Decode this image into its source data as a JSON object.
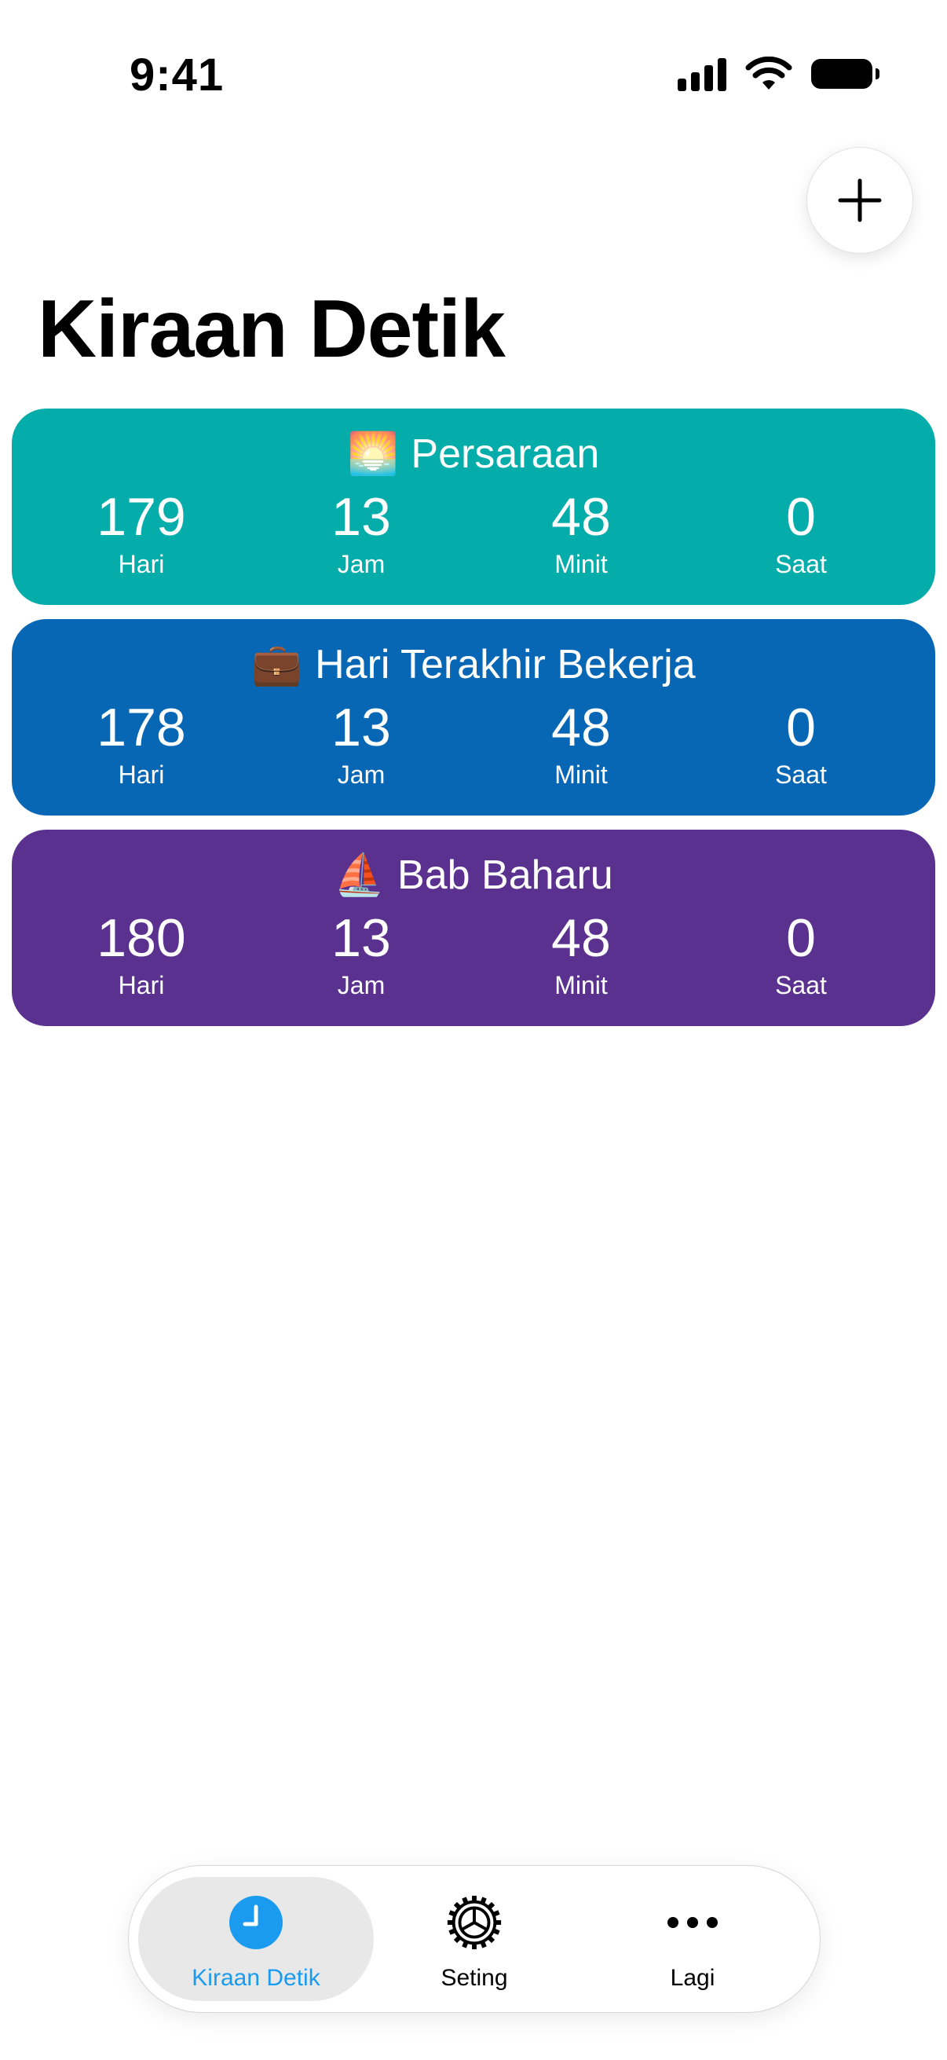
{
  "status_bar": {
    "time": "9:41"
  },
  "title": "Kiraan Detik",
  "unit_labels": [
    "Hari",
    "Jam",
    "Minit",
    "Saat"
  ],
  "countdowns": [
    {
      "emoji": "🌅",
      "name": "Persaraan",
      "values": [
        "179",
        "13",
        "48",
        "0"
      ],
      "color": "#04ADAA"
    },
    {
      "emoji": "💼",
      "name": "Hari Terakhir Bekerja",
      "values": [
        "178",
        "13",
        "48",
        "0"
      ],
      "color": "#0867B5"
    },
    {
      "emoji": "⛵",
      "name": "Bab Baharu",
      "values": [
        "180",
        "13",
        "48",
        "0"
      ],
      "color": "#5A318F"
    }
  ],
  "tabs": [
    {
      "label": "Kiraan Detik",
      "icon": "clock-icon",
      "active": true
    },
    {
      "label": "Seting",
      "icon": "gear-icon",
      "active": false
    },
    {
      "label": "Lagi",
      "icon": "more-icon",
      "active": false
    }
  ],
  "colors": {
    "accent": "#1A9BF0"
  }
}
